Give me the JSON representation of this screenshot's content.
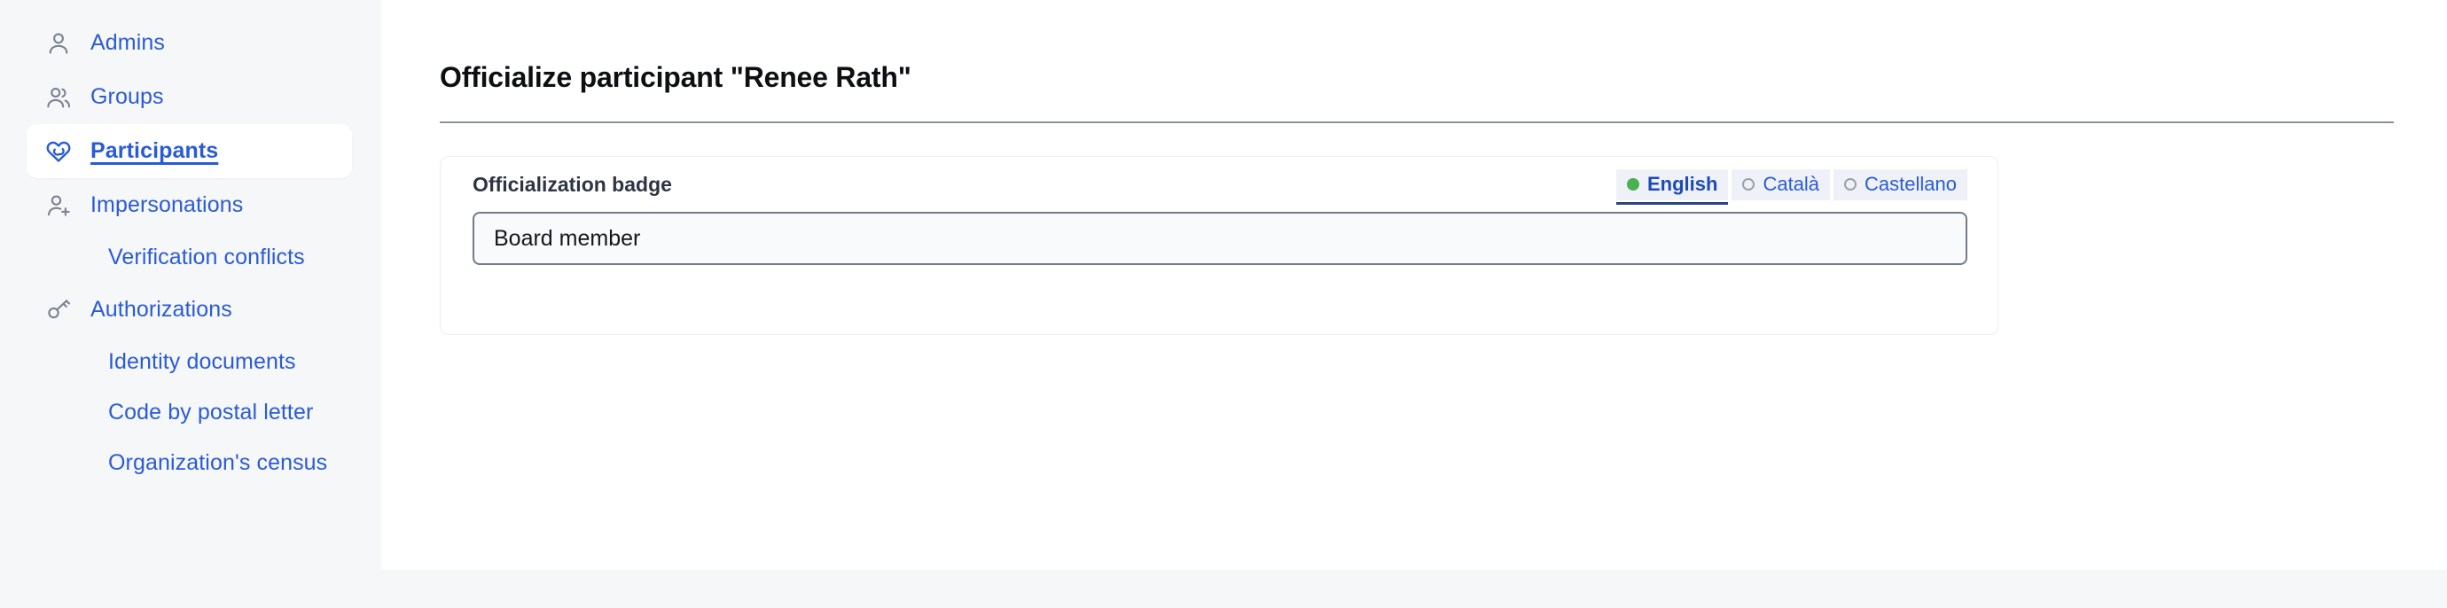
{
  "sidebar": {
    "items": [
      {
        "label": "Admins",
        "icon": "user-icon",
        "active": false,
        "sub": false
      },
      {
        "label": "Groups",
        "icon": "users-icon",
        "active": false,
        "sub": false
      },
      {
        "label": "Participants",
        "icon": "participants-heart-icon",
        "active": true,
        "sub": false
      },
      {
        "label": "Impersonations",
        "icon": "user-add-icon",
        "active": false,
        "sub": false
      },
      {
        "label": "Verification conflicts",
        "icon": "",
        "active": false,
        "sub": true
      },
      {
        "label": "Authorizations",
        "icon": "key-icon",
        "active": false,
        "sub": false
      },
      {
        "label": "Identity documents",
        "icon": "",
        "active": false,
        "sub": true
      },
      {
        "label": "Code by postal letter",
        "icon": "",
        "active": false,
        "sub": true
      },
      {
        "label": "Organization's census",
        "icon": "",
        "active": false,
        "sub": true
      }
    ]
  },
  "main": {
    "page_title": "Officialize participant \"Renee Rath\"",
    "card": {
      "field_label": "Officialization badge",
      "language_tabs": [
        {
          "label": "English",
          "selected": true,
          "has_content": true
        },
        {
          "label": "Català",
          "selected": false,
          "has_content": false
        },
        {
          "label": "Castellano",
          "selected": false,
          "has_content": false
        }
      ],
      "badge_input": {
        "value": "Board member",
        "placeholder": ""
      }
    }
  },
  "colors": {
    "link_blue": "#2a5bd7",
    "active_underline": "#27457f",
    "filled_dot_green": "#4caf50",
    "empty_dot_gray": "#9aa1ad",
    "page_bg": "#f6f7f9",
    "panel_bg": "#ffffff",
    "rule_gray": "#8c93a0",
    "input_border": "#747b88"
  }
}
